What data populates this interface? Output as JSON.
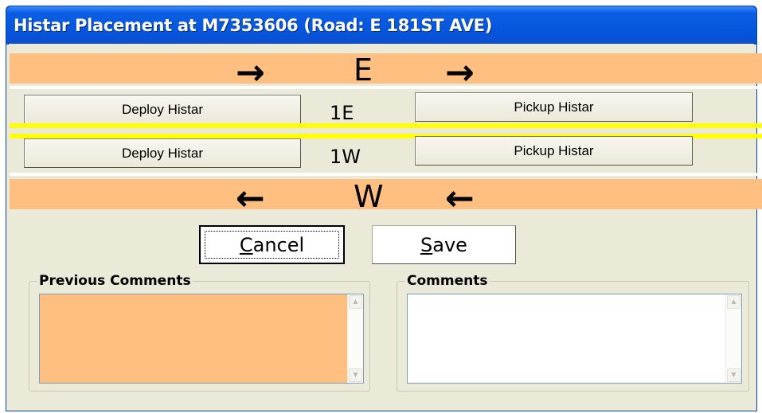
{
  "window": {
    "title": "Histar Placement at M7353606 (Road: E 181ST AVE)"
  },
  "eastbound": {
    "direction_letter": "E",
    "arrow_glyph": "→",
    "lane_label": "1E",
    "deploy_label": "Deploy Histar",
    "pickup_label": "Pickup Histar"
  },
  "westbound": {
    "direction_letter": "W",
    "arrow_glyph": "←",
    "lane_label": "1W",
    "deploy_label": "Deploy Histar",
    "pickup_label": "Pickup Histar"
  },
  "actions": {
    "cancel": {
      "mnemonic": "C",
      "rest": "ancel"
    },
    "save": {
      "mnemonic": "S",
      "rest": "ave"
    }
  },
  "previous_comments": {
    "title": "Previous Comments",
    "value": ""
  },
  "comments": {
    "title": "Comments",
    "value": ""
  },
  "colors": {
    "band": "#ffbf80",
    "lane_divider": "#ffff00",
    "titlebar": "#0a5be0",
    "dialog_bg": "#ebe9d8"
  },
  "icons": {
    "scroll_up": "▲",
    "scroll_down": "▼"
  }
}
